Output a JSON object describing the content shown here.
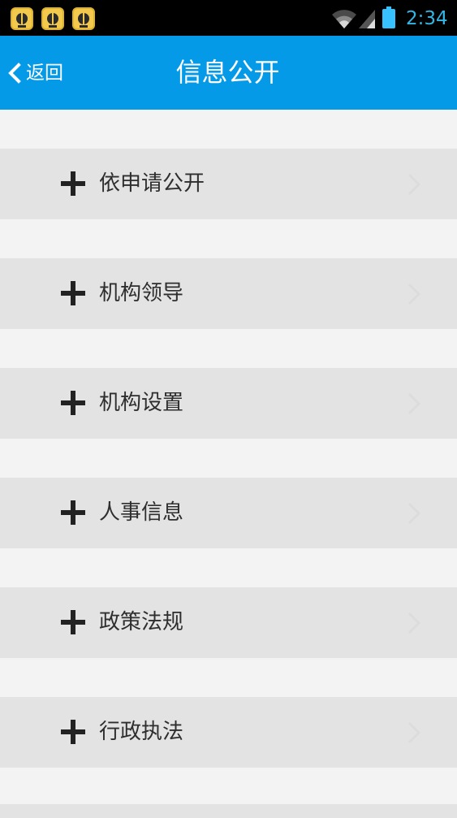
{
  "status_bar": {
    "time": "2:34",
    "notification_icons": [
      "app-notification-icon",
      "app-notification-icon",
      "app-notification-icon"
    ],
    "wifi_icon": "wifi-icon",
    "signal_icon": "cell-signal-icon",
    "battery_icon": "battery-icon",
    "clock_color": "#33b5e5"
  },
  "app_bar": {
    "back_label": "返回",
    "title": "信息公开",
    "color": "#049ae8"
  },
  "list": {
    "items": [
      {
        "label": "依申请公开"
      },
      {
        "label": "机构领导"
      },
      {
        "label": "机构设置"
      },
      {
        "label": "人事信息"
      },
      {
        "label": "政策法规"
      },
      {
        "label": "行政执法"
      }
    ],
    "row_color": "#e3e3e3",
    "gap_color": "#f3f3f3"
  }
}
